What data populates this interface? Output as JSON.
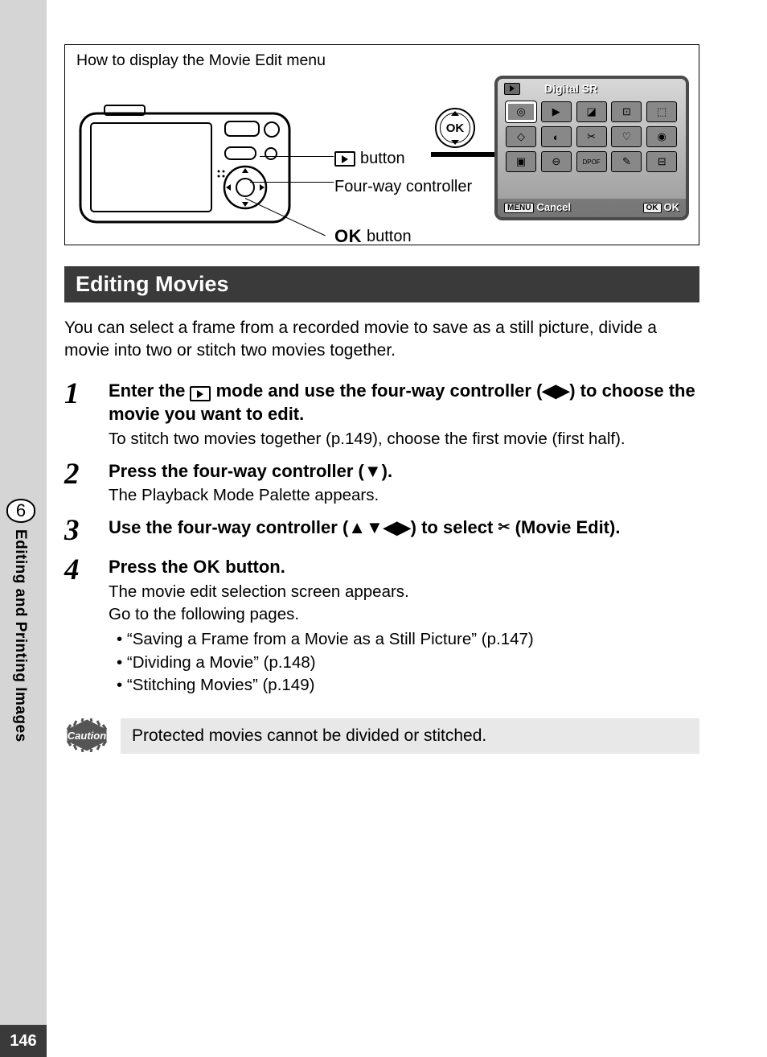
{
  "page_number": "146",
  "section_number": "6",
  "section_label": "Editing and Printing Images",
  "diagram": {
    "title": "How to display the Movie Edit menu",
    "callout_play_button": "button",
    "callout_fourway": "Four-way controller",
    "callout_ok_button": "button",
    "ok_label": "OK"
  },
  "screen": {
    "header_title": "Digital SR",
    "footer_menu_badge": "MENU",
    "footer_cancel": "Cancel",
    "footer_ok_badge": "OK",
    "footer_ok": "OK"
  },
  "heading": "Editing Movies",
  "intro": "You can select a frame from a recorded movie to save as a still picture, divide a movie into two or stitch two movies together.",
  "steps": {
    "s1": {
      "num": "1",
      "title_a": "Enter the ",
      "title_b": " mode and use the four-way controller (◀▶) to choose the movie you want to edit.",
      "desc": "To stitch two movies together (p.149), choose the first movie (first half)."
    },
    "s2": {
      "num": "2",
      "title": "Press the four-way controller (▼).",
      "desc": "The Playback Mode Palette appears."
    },
    "s3": {
      "num": "3",
      "title_a": "Use the four-way controller (▲▼◀▶) to select ",
      "title_b": " (Movie Edit)."
    },
    "s4": {
      "num": "4",
      "title_a": "Press the ",
      "title_ok": "OK",
      "title_b": " button.",
      "desc_a": "The movie edit selection screen appears.",
      "desc_b": "Go to the following pages.",
      "bullets": [
        "“Saving a Frame from a Movie as a Still Picture” (p.147)",
        "“Dividing a Movie” (p.148)",
        "“Stitching Movies” (p.149)"
      ]
    }
  },
  "caution": {
    "badge": "Caution",
    "text": "Protected movies cannot be divided or stitched."
  }
}
